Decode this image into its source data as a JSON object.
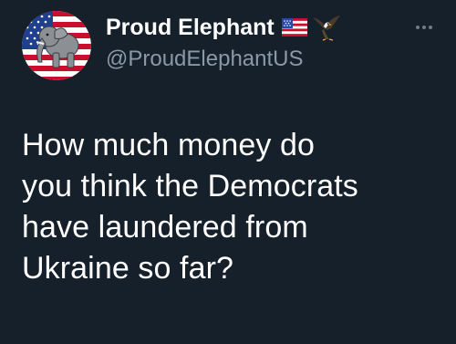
{
  "author": {
    "display_name": "Proud Elephant",
    "handle": "@ProudElephantUS",
    "avatar_icon": "elephant-flag-avatar",
    "name_emojis": [
      "us-flag-icon",
      "eagle-icon"
    ]
  },
  "tweet": {
    "text": "How much money do\nyou think the Democrats\nhave laundered from\nUkraine so far?"
  },
  "colors": {
    "background": "#15202b",
    "text": "#ffffff",
    "secondary_text": "#8b98a5"
  }
}
